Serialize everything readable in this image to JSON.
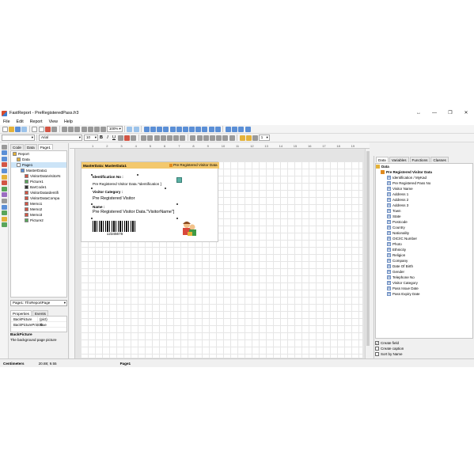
{
  "window": {
    "title": "FastReport - PreRegisteredPass.fr3",
    "controls": [
      "↔",
      "—",
      "❐",
      "✕"
    ]
  },
  "menu": [
    "File",
    "Edit",
    "Report",
    "View",
    "Help"
  ],
  "toolbar": {
    "zoom": "100%",
    "font_name": "Arial",
    "font_size": "10",
    "bold": "B",
    "italic": "I",
    "underline": "U",
    "line_width": "1"
  },
  "left_tabs": [
    "Code",
    "Data",
    "Page1"
  ],
  "report_tree": [
    {
      "label": "Report",
      "level": 0,
      "color": "#e4b23a"
    },
    {
      "label": "Data",
      "level": 1,
      "color": "#e4b23a"
    },
    {
      "label": "Page1",
      "level": 1,
      "color": "#ffffff"
    },
    {
      "label": "MasterData1",
      "level": 2,
      "color": "#5b8fd6"
    },
    {
      "label": "VisitorDataVisitorN",
      "level": 3,
      "color": "#d25545"
    },
    {
      "label": "Picture1",
      "level": 3,
      "color": "#59a55a"
    },
    {
      "label": "BarCode1",
      "level": 3,
      "color": "#333333"
    },
    {
      "label": "VisitorDataIdentifi",
      "level": 3,
      "color": "#d25545"
    },
    {
      "label": "VisitorDataCompa",
      "level": 3,
      "color": "#d25545"
    },
    {
      "label": "Memo1",
      "level": 3,
      "color": "#d25545"
    },
    {
      "label": "Memo2",
      "level": 3,
      "color": "#d25545"
    },
    {
      "label": "Memo3",
      "level": 3,
      "color": "#d25545"
    },
    {
      "label": "Picture2",
      "level": 3,
      "color": "#59a55a"
    }
  ],
  "object_selector": "Page1: TfrxReportPage",
  "props_tabs": [
    "Properties",
    "Events"
  ],
  "properties": [
    {
      "name": "BackPicture",
      "value": "(pict)"
    },
    {
      "name": "BackPicturePrintab",
      "value": "True"
    }
  ],
  "prop_desc": {
    "title": "BackPicture",
    "text": "The background page picture"
  },
  "ruler": [
    "1",
    "2",
    "3",
    "4",
    "5",
    "6",
    "7",
    "8",
    "9",
    "10",
    "11",
    "12",
    "13",
    "14",
    "15",
    "16",
    "17",
    "18",
    "19"
  ],
  "band": {
    "title": "MasterData: MasterData1",
    "dataset": "Pre Registered Visitor Data"
  },
  "report_items": {
    "id_label": "Identification No :",
    "id_field": "Pre Registered Visitor Data.\"Identification ]",
    "category_label": "Visitor Category :",
    "category_value": "Pre Registered Visitor",
    "name_label": "Name :",
    "name_field": "Pre Registered Visitor Data.\"VisitorName\"]",
    "barcode_number": "12345678"
  },
  "right_tabs": [
    "Data",
    "Variables",
    "Functions",
    "Classes"
  ],
  "data_tree": {
    "root": "Data",
    "dataset": "Pre Registered Visitor Data",
    "fields": [
      "Identification / MyKad",
      "Pre Registered Pass No",
      "Visitor Name",
      "Address 1",
      "Address 2",
      "Address 3",
      "Town",
      "State",
      "Postcode",
      "Country",
      "Nationality",
      "OIC/IC Number",
      "Photo",
      "Ethnicity",
      "Religion",
      "Company",
      "Date Of Birth",
      "Gender",
      "Telephone No",
      "Visitor Category",
      "Pass Issue Date",
      "Pass Expiry Date"
    ]
  },
  "checkboxes": [
    {
      "label": "Create field",
      "checked": true
    },
    {
      "label": "Create caption",
      "checked": false
    },
    {
      "label": "Sort by Name",
      "checked": false
    }
  ],
  "status": {
    "units": "Centimeters",
    "coords": "20.88; 9.55",
    "page": "Page1"
  }
}
